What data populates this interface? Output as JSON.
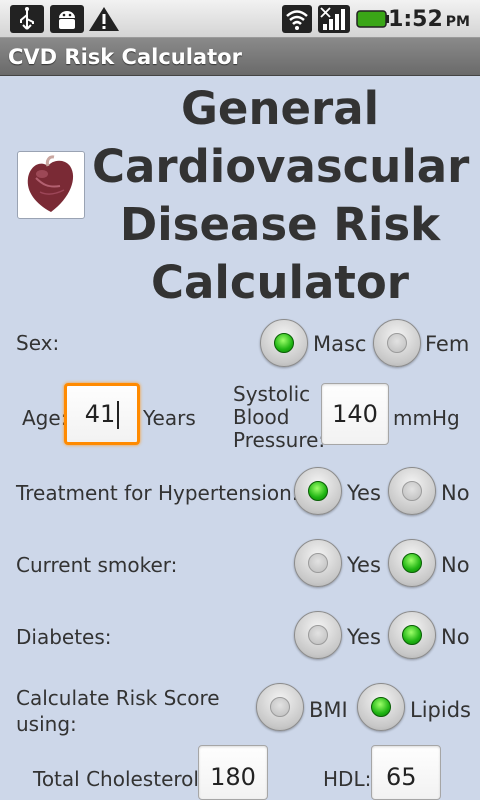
{
  "status_bar": {
    "time": "1:52",
    "ampm": "PM",
    "icons": [
      "usb-icon",
      "android-debug-icon",
      "warning-icon",
      "wifi-icon",
      "signal-icon",
      "battery-icon"
    ]
  },
  "app": {
    "title": "CVD Risk Calculator"
  },
  "header": {
    "title_lines": [
      "General",
      "Cardiovascular",
      "Disease Risk",
      "Calculator"
    ]
  },
  "form": {
    "sex": {
      "label": "Sex:",
      "options": [
        "Masc",
        "Fem"
      ],
      "selected": "Masc"
    },
    "age": {
      "label": "Age:",
      "value": "41",
      "unit": "Years"
    },
    "sbp": {
      "label_lines": [
        "Systolic",
        "Blood",
        "Pressure:"
      ],
      "value": "140",
      "unit": "mmHg"
    },
    "treatment": {
      "label": "Treatment for Hypertension:",
      "options": [
        "Yes",
        "No"
      ],
      "selected": "Yes"
    },
    "smoker": {
      "label": "Current smoker:",
      "options": [
        "Yes",
        "No"
      ],
      "selected": "No"
    },
    "diabetes": {
      "label": "Diabetes:",
      "options": [
        "Yes",
        "No"
      ],
      "selected": "No"
    },
    "method": {
      "label_lines": [
        "Calculate Risk Score",
        "using:"
      ],
      "options": [
        "BMI",
        "Lipids"
      ],
      "selected": "Lipids"
    },
    "cholesterol": {
      "label": "Total Cholesterol:",
      "value": "180"
    },
    "hdl": {
      "label": "HDL:",
      "value": "65"
    }
  },
  "colors": {
    "accent_focus": "#ff8a00",
    "radio_on": "#1fb413",
    "background": "#cdd7e9"
  }
}
